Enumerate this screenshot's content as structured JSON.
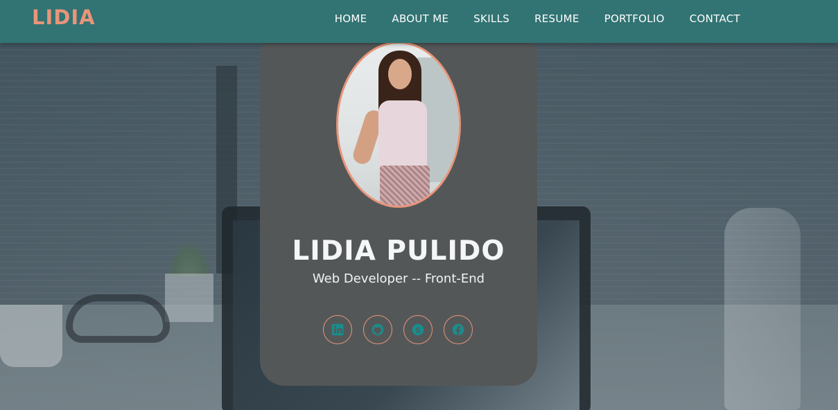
{
  "header": {
    "logo": "LIDIA",
    "nav": [
      {
        "label": "HOME"
      },
      {
        "label": "ABOUT ME"
      },
      {
        "label": "SKILLS"
      },
      {
        "label": "RESUME"
      },
      {
        "label": "PORTFOLIO"
      },
      {
        "label": "CONTACT"
      }
    ]
  },
  "card": {
    "name": "LIDIA PULIDO",
    "title": "Web Developer -- Front-End",
    "socials": [
      {
        "icon": "linkedin-icon"
      },
      {
        "icon": "github-icon"
      },
      {
        "icon": "skype-icon"
      },
      {
        "icon": "facebook-icon"
      }
    ]
  },
  "colors": {
    "header_bg": "#327373",
    "accent": "#e8957a",
    "card_bg": "#545758",
    "icon": "#1a8c8c"
  }
}
